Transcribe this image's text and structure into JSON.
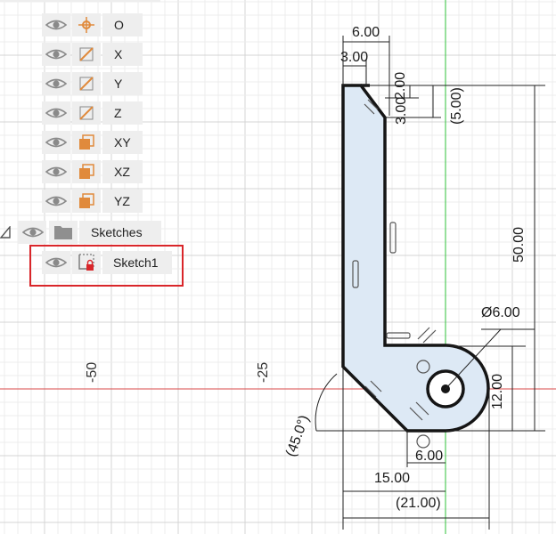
{
  "browser": {
    "items": [
      {
        "label": "O",
        "icon": "origin-point-icon"
      },
      {
        "label": "X",
        "icon": "axis-icon"
      },
      {
        "label": "Y",
        "icon": "axis-icon"
      },
      {
        "label": "Z",
        "icon": "axis-icon"
      },
      {
        "label": "XY",
        "icon": "plane-icon"
      },
      {
        "label": "XZ",
        "icon": "plane-icon"
      },
      {
        "label": "YZ",
        "icon": "plane-icon"
      }
    ],
    "folder": {
      "label": "Sketches",
      "icon": "folder-icon"
    },
    "sketch": {
      "label": "Sketch1",
      "icon": "sketch-locked-icon"
    }
  },
  "grid": {
    "labels": {
      "minus50": "-50",
      "minus25": "-25"
    }
  },
  "dimensions": {
    "d1": "6.00",
    "d2": "3.00",
    "d3": "2.00",
    "d4": "3.00",
    "d5": "(5.00)",
    "d6": "50.00",
    "d7": "Ø6.00",
    "d8": "12.00",
    "d9": "(45.0°)",
    "d10": "6.00",
    "d11": "15.00",
    "d12": "(21.00)"
  },
  "colors": {
    "accent_orange": "#e08a3c",
    "x_axis": "#d94a4a",
    "y_axis": "#2fc23a",
    "profile_fill": "#dde9f5",
    "highlight": "#d9262a"
  }
}
